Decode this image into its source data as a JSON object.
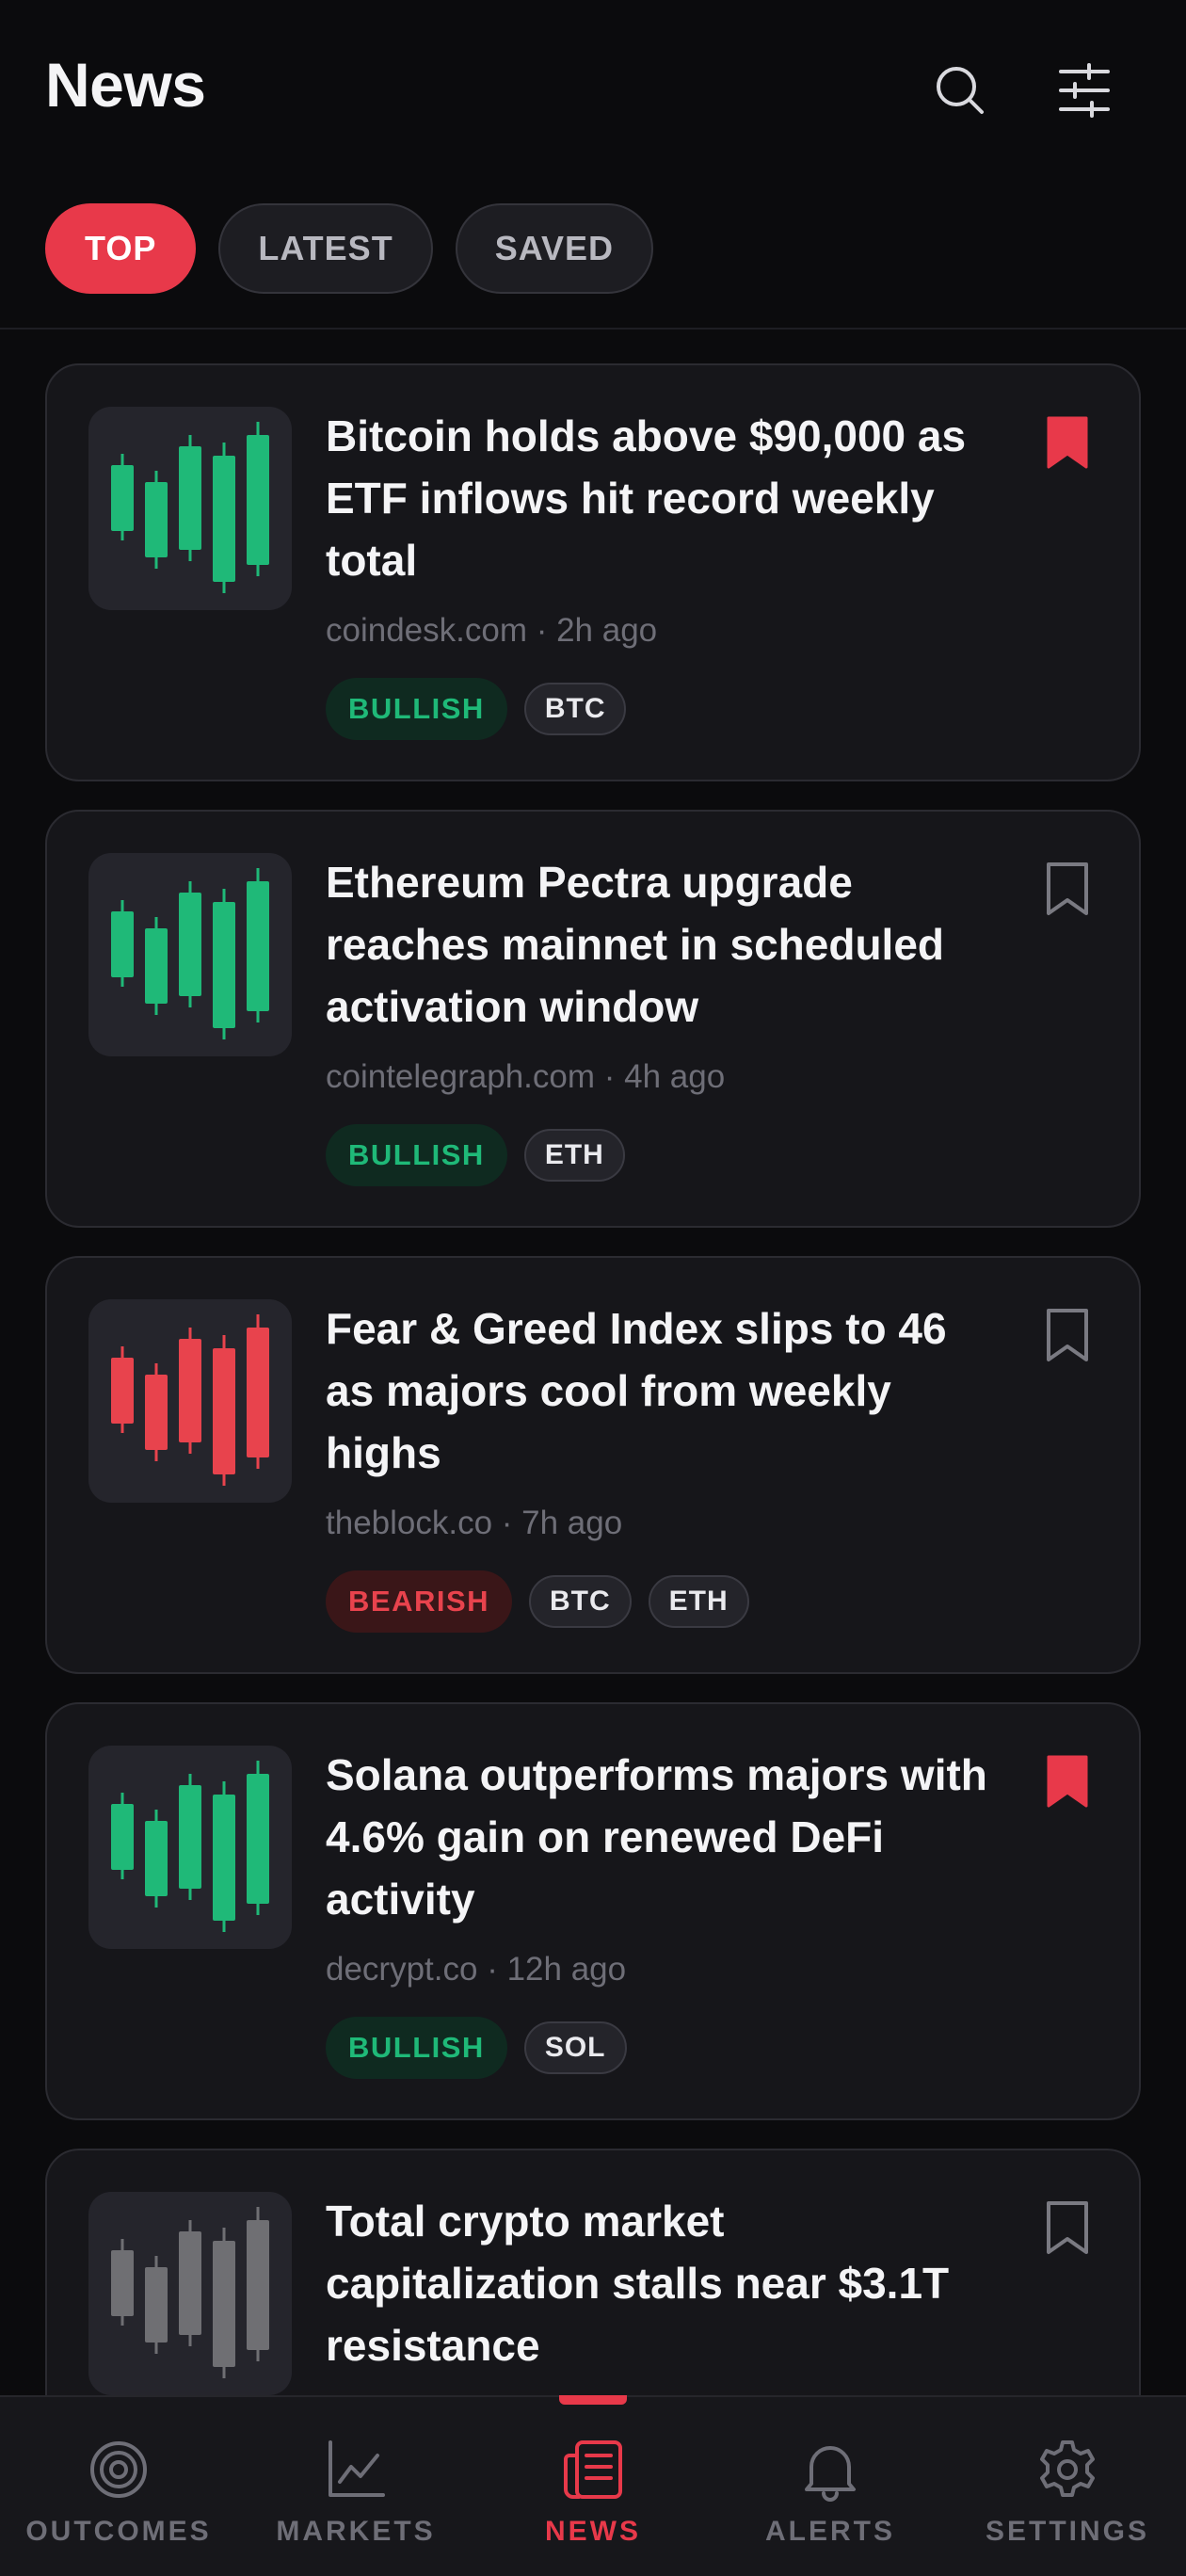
{
  "header": {
    "title": "News",
    "tabs": [
      {
        "label": "TOP",
        "active": true
      },
      {
        "label": "LATEST",
        "active": false
      },
      {
        "label": "SAVED",
        "active": false
      }
    ]
  },
  "colors": {
    "accent": "#e8394a",
    "bullish": "#1fb978",
    "bearish": "#e8434d",
    "neutral": "#6f6f73"
  },
  "articles": [
    {
      "headline": "Bitcoin holds above $90,000 as ETF inflows hit record weekly total",
      "source": "coindesk.com",
      "age": "2h ago",
      "meta": "coindesk.com · 2h ago",
      "sentiment": "BULLISH",
      "tickers": [
        "BTC"
      ],
      "saved": true,
      "thumb_tone": "bullish"
    },
    {
      "headline": "Ethereum Pectra upgrade reaches mainnet in scheduled activation window",
      "source": "cointelegraph.com",
      "age": "4h ago",
      "meta": "cointelegraph.com · 4h ago",
      "sentiment": "BULLISH",
      "tickers": [
        "ETH"
      ],
      "saved": false,
      "thumb_tone": "bullish"
    },
    {
      "headline": "Fear & Greed Index slips to 46 as majors cool from weekly highs",
      "source": "theblock.co",
      "age": "7h ago",
      "meta": "theblock.co · 7h ago",
      "sentiment": "BEARISH",
      "tickers": [
        "BTC",
        "ETH"
      ],
      "saved": false,
      "thumb_tone": "bearish"
    },
    {
      "headline": "Solana outperforms majors with 4.6% gain on renewed DeFi activity",
      "source": "decrypt.co",
      "age": "12h ago",
      "meta": "decrypt.co · 12h ago",
      "sentiment": "BULLISH",
      "tickers": [
        "SOL"
      ],
      "saved": true,
      "thumb_tone": "bullish"
    },
    {
      "headline": "Total crypto market capitalization stalls near $3.1T resistance",
      "saved": false,
      "thumb_tone": "neutral"
    }
  ],
  "bottom_nav": [
    {
      "label": "OUTCOMES",
      "icon": "target-icon",
      "active": false
    },
    {
      "label": "MARKETS",
      "icon": "line-chart-icon",
      "active": false
    },
    {
      "label": "NEWS",
      "icon": "newspaper-icon",
      "active": true
    },
    {
      "label": "ALERTS",
      "icon": "bell-icon",
      "active": false
    },
    {
      "label": "SETTINGS",
      "icon": "gear-icon",
      "active": false
    }
  ]
}
